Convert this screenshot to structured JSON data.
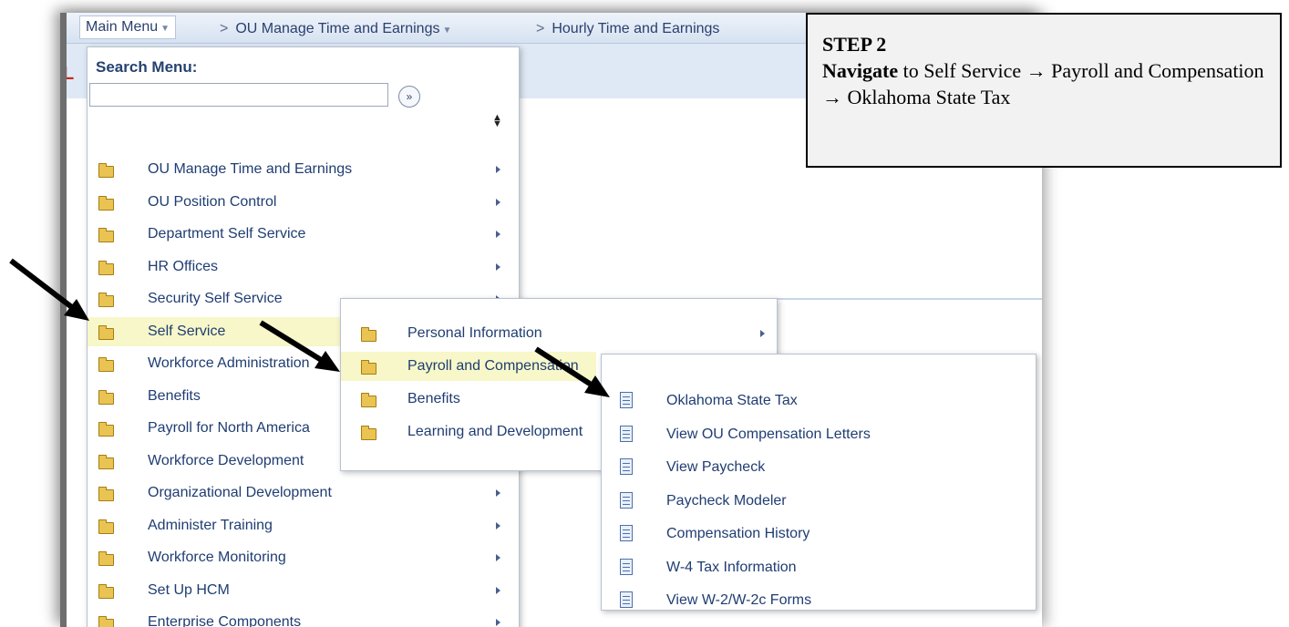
{
  "breadcrumb": {
    "main": "Main Menu",
    "items": [
      "OU Manage Time and Earnings",
      "Hourly Time and Earnings"
    ]
  },
  "search": {
    "label": "Search Menu:",
    "value": "",
    "placeholder": ""
  },
  "menu": {
    "items": [
      {
        "label": "OU Manage Time and Earnings",
        "submenu": true
      },
      {
        "label": "OU Position Control",
        "submenu": true
      },
      {
        "label": "Department Self Service",
        "submenu": true
      },
      {
        "label": "HR Offices",
        "submenu": true
      },
      {
        "label": "Security Self Service",
        "submenu": true
      },
      {
        "label": "Self Service",
        "submenu": true,
        "highlighted": true
      },
      {
        "label": "Workforce Administration",
        "submenu": true
      },
      {
        "label": "Benefits",
        "submenu": true
      },
      {
        "label": "Payroll for North America",
        "submenu": true
      },
      {
        "label": "Workforce Development",
        "submenu": true
      },
      {
        "label": "Organizational Development",
        "submenu": true
      },
      {
        "label": "Administer Training",
        "submenu": true
      },
      {
        "label": "Workforce Monitoring",
        "submenu": true
      },
      {
        "label": "Set Up HCM",
        "submenu": true
      },
      {
        "label": "Enterprise Components",
        "submenu": true
      }
    ]
  },
  "self_service_menu": {
    "items": [
      {
        "label": "Personal Information",
        "submenu": true
      },
      {
        "label": "Payroll and Compensation",
        "highlighted": true
      },
      {
        "label": "Benefits"
      },
      {
        "label": "Learning and Development"
      }
    ]
  },
  "payroll_menu": {
    "items": [
      {
        "label": "Oklahoma State Tax"
      },
      {
        "label": "View OU Compensation Letters"
      },
      {
        "label": "View Paycheck"
      },
      {
        "label": "Paycheck Modeler"
      },
      {
        "label": "Compensation History"
      },
      {
        "label": "W-4 Tax Information"
      },
      {
        "label": "View W-2/W-2c Forms"
      }
    ]
  },
  "callout": {
    "step": "STEP 2",
    "verb": "Navigate",
    "text1": " to Self Service ",
    "arrow": "→",
    "text2": " Payroll and Compensation ",
    "text3": " Oklahoma State Tax"
  },
  "colors": {
    "highlight": "#f7f7c9",
    "menu_text": "#1f3d72",
    "folder": "#e9c453",
    "callout_bg": "#f2f2f2"
  }
}
